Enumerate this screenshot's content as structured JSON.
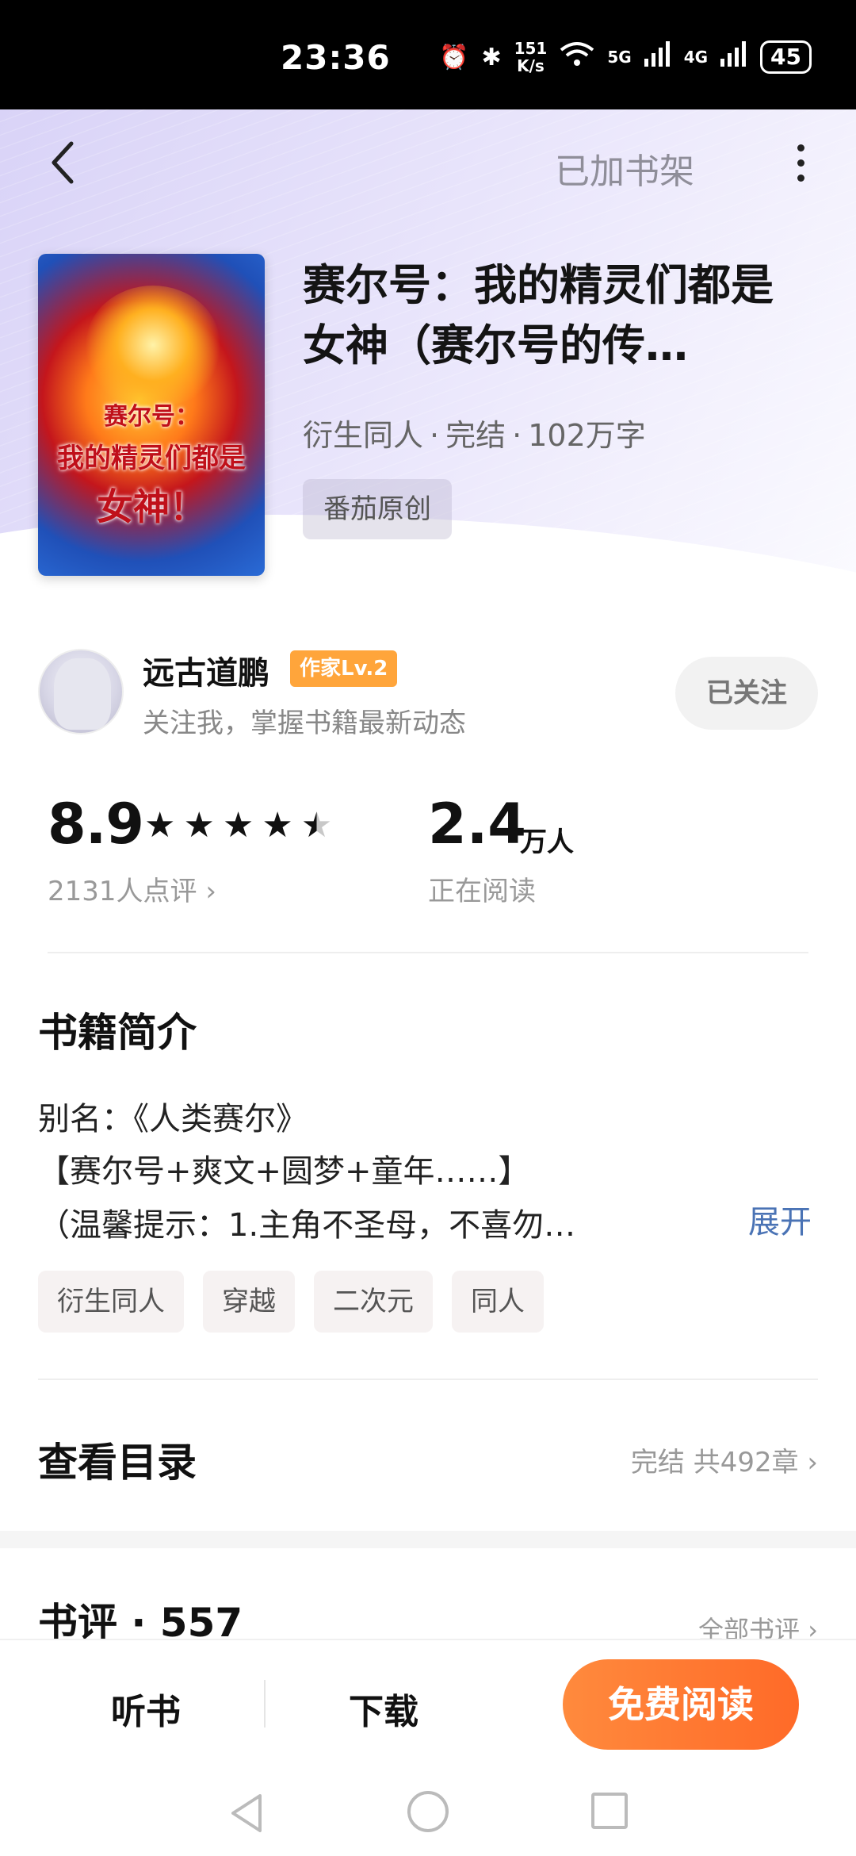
{
  "status_bar": {
    "time": "23:36",
    "net_speed_top": "151",
    "net_speed_bottom": "K/s",
    "net_5g": "5G",
    "net_4g": "4G",
    "battery": "45"
  },
  "header": {
    "shelf_label": "已加书架"
  },
  "book": {
    "title": "赛尔号：我的精灵们都是女神（赛尔号的传…",
    "meta_genre": "衍生同人",
    "meta_status": "完结",
    "meta_words": "102万字",
    "origin_tag": "番茄原创",
    "cover_text": [
      "赛尔号：",
      "我的精灵们都是",
      "女神！"
    ]
  },
  "author": {
    "name": "远古道鹏",
    "badge": "作家Lv.2",
    "desc": "关注我，掌握书籍最新动态",
    "follow_label": "已关注"
  },
  "stats": {
    "score": "8.9",
    "stars": 4.5,
    "reviews_link": "2131人点评 ›",
    "readers": "2.4",
    "readers_unit": "万人",
    "readers_label": "正在阅读"
  },
  "intro": {
    "title": "书籍简介",
    "lines": [
      "别名：《人类赛尔》",
      "【赛尔号+爽文+圆梦+童年……】",
      "（温馨提示：1.主角不圣母，不喜勿…"
    ],
    "expand_label": "展开",
    "tags": [
      "衍生同人",
      "穿越",
      "二次元",
      "同人"
    ]
  },
  "toc": {
    "title": "查看目录",
    "meta": "完结 共492章 ›"
  },
  "reviews": {
    "title": "书评 · 557",
    "all_label": "全部书评 ›"
  },
  "actions": {
    "listen": "听书",
    "download": "下载",
    "read": "免费阅读"
  }
}
